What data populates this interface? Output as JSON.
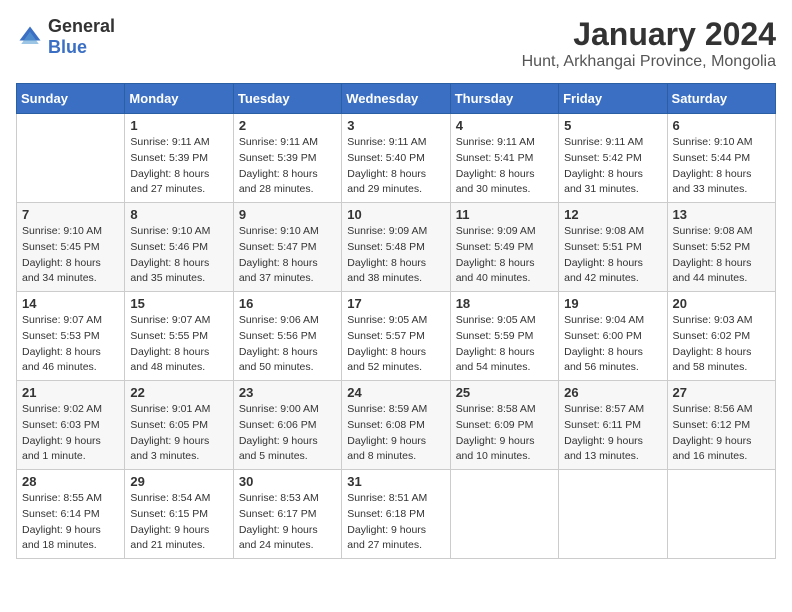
{
  "header": {
    "logo": {
      "general": "General",
      "blue": "Blue"
    },
    "title": "January 2024",
    "subtitle": "Hunt, Arkhangai Province, Mongolia"
  },
  "weekdays": [
    "Sunday",
    "Monday",
    "Tuesday",
    "Wednesday",
    "Thursday",
    "Friday",
    "Saturday"
  ],
  "weeks": [
    [
      {
        "day": null,
        "info": null
      },
      {
        "day": "1",
        "info": "Sunrise: 9:11 AM\nSunset: 5:39 PM\nDaylight: 8 hours\nand 27 minutes."
      },
      {
        "day": "2",
        "info": "Sunrise: 9:11 AM\nSunset: 5:39 PM\nDaylight: 8 hours\nand 28 minutes."
      },
      {
        "day": "3",
        "info": "Sunrise: 9:11 AM\nSunset: 5:40 PM\nDaylight: 8 hours\nand 29 minutes."
      },
      {
        "day": "4",
        "info": "Sunrise: 9:11 AM\nSunset: 5:41 PM\nDaylight: 8 hours\nand 30 minutes."
      },
      {
        "day": "5",
        "info": "Sunrise: 9:11 AM\nSunset: 5:42 PM\nDaylight: 8 hours\nand 31 minutes."
      },
      {
        "day": "6",
        "info": "Sunrise: 9:10 AM\nSunset: 5:44 PM\nDaylight: 8 hours\nand 33 minutes."
      }
    ],
    [
      {
        "day": "7",
        "info": "Sunrise: 9:10 AM\nSunset: 5:45 PM\nDaylight: 8 hours\nand 34 minutes."
      },
      {
        "day": "8",
        "info": "Sunrise: 9:10 AM\nSunset: 5:46 PM\nDaylight: 8 hours\nand 35 minutes."
      },
      {
        "day": "9",
        "info": "Sunrise: 9:10 AM\nSunset: 5:47 PM\nDaylight: 8 hours\nand 37 minutes."
      },
      {
        "day": "10",
        "info": "Sunrise: 9:09 AM\nSunset: 5:48 PM\nDaylight: 8 hours\nand 38 minutes."
      },
      {
        "day": "11",
        "info": "Sunrise: 9:09 AM\nSunset: 5:49 PM\nDaylight: 8 hours\nand 40 minutes."
      },
      {
        "day": "12",
        "info": "Sunrise: 9:08 AM\nSunset: 5:51 PM\nDaylight: 8 hours\nand 42 minutes."
      },
      {
        "day": "13",
        "info": "Sunrise: 9:08 AM\nSunset: 5:52 PM\nDaylight: 8 hours\nand 44 minutes."
      }
    ],
    [
      {
        "day": "14",
        "info": "Sunrise: 9:07 AM\nSunset: 5:53 PM\nDaylight: 8 hours\nand 46 minutes."
      },
      {
        "day": "15",
        "info": "Sunrise: 9:07 AM\nSunset: 5:55 PM\nDaylight: 8 hours\nand 48 minutes."
      },
      {
        "day": "16",
        "info": "Sunrise: 9:06 AM\nSunset: 5:56 PM\nDaylight: 8 hours\nand 50 minutes."
      },
      {
        "day": "17",
        "info": "Sunrise: 9:05 AM\nSunset: 5:57 PM\nDaylight: 8 hours\nand 52 minutes."
      },
      {
        "day": "18",
        "info": "Sunrise: 9:05 AM\nSunset: 5:59 PM\nDaylight: 8 hours\nand 54 minutes."
      },
      {
        "day": "19",
        "info": "Sunrise: 9:04 AM\nSunset: 6:00 PM\nDaylight: 8 hours\nand 56 minutes."
      },
      {
        "day": "20",
        "info": "Sunrise: 9:03 AM\nSunset: 6:02 PM\nDaylight: 8 hours\nand 58 minutes."
      }
    ],
    [
      {
        "day": "21",
        "info": "Sunrise: 9:02 AM\nSunset: 6:03 PM\nDaylight: 9 hours\nand 1 minute."
      },
      {
        "day": "22",
        "info": "Sunrise: 9:01 AM\nSunset: 6:05 PM\nDaylight: 9 hours\nand 3 minutes."
      },
      {
        "day": "23",
        "info": "Sunrise: 9:00 AM\nSunset: 6:06 PM\nDaylight: 9 hours\nand 5 minutes."
      },
      {
        "day": "24",
        "info": "Sunrise: 8:59 AM\nSunset: 6:08 PM\nDaylight: 9 hours\nand 8 minutes."
      },
      {
        "day": "25",
        "info": "Sunrise: 8:58 AM\nSunset: 6:09 PM\nDaylight: 9 hours\nand 10 minutes."
      },
      {
        "day": "26",
        "info": "Sunrise: 8:57 AM\nSunset: 6:11 PM\nDaylight: 9 hours\nand 13 minutes."
      },
      {
        "day": "27",
        "info": "Sunrise: 8:56 AM\nSunset: 6:12 PM\nDaylight: 9 hours\nand 16 minutes."
      }
    ],
    [
      {
        "day": "28",
        "info": "Sunrise: 8:55 AM\nSunset: 6:14 PM\nDaylight: 9 hours\nand 18 minutes."
      },
      {
        "day": "29",
        "info": "Sunrise: 8:54 AM\nSunset: 6:15 PM\nDaylight: 9 hours\nand 21 minutes."
      },
      {
        "day": "30",
        "info": "Sunrise: 8:53 AM\nSunset: 6:17 PM\nDaylight: 9 hours\nand 24 minutes."
      },
      {
        "day": "31",
        "info": "Sunrise: 8:51 AM\nSunset: 6:18 PM\nDaylight: 9 hours\nand 27 minutes."
      },
      {
        "day": null,
        "info": null
      },
      {
        "day": null,
        "info": null
      },
      {
        "day": null,
        "info": null
      }
    ]
  ]
}
